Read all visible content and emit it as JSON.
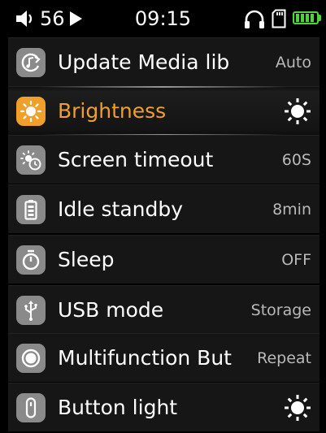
{
  "status_bar": {
    "volume_icon": "speaker-icon",
    "volume": "56",
    "play_state_icon": "play-icon",
    "time": "09:15",
    "headphones_icon": "headphones-icon",
    "sd_card_icon": "sd-card-icon",
    "battery_icon": "battery-icon",
    "battery_level": 1.0,
    "battery_color": "#4fd43c"
  },
  "menu": {
    "selected_index": 1,
    "accent_color": "#f0a02a",
    "items": [
      {
        "icon": "refresh-music-icon",
        "label": "Update Media lib",
        "value": "Auto"
      },
      {
        "icon": "brightness-icon",
        "label": "Brightness",
        "value_icon": "sun-icon"
      },
      {
        "icon": "screen-timeout-icon",
        "label": "Screen timeout",
        "value": "60S"
      },
      {
        "icon": "battery-standby-icon",
        "label": "Idle standby",
        "value": "8min"
      },
      {
        "icon": "timer-icon",
        "label": "Sleep",
        "value": "OFF"
      },
      {
        "icon": "usb-icon",
        "label": "USB mode",
        "value": "Storage"
      },
      {
        "icon": "multifunction-button-icon",
        "label": "Multifunction But",
        "value": "Repeat"
      },
      {
        "icon": "button-light-icon",
        "label": "Button light",
        "value_icon": "sun-icon"
      }
    ]
  }
}
